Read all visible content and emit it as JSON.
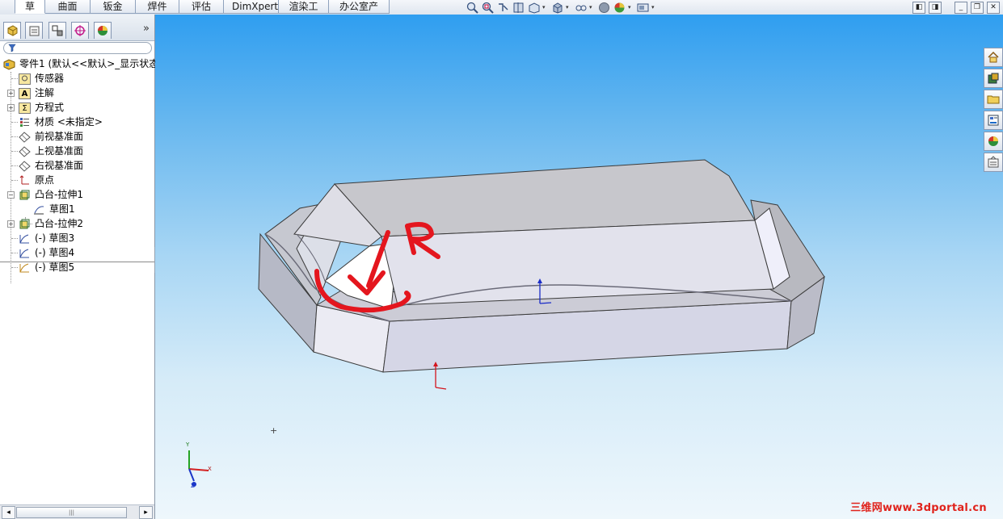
{
  "tabs": [
    "草图",
    "曲面",
    "钣金",
    "焊件",
    "评估",
    "DimXpert",
    "渲染工具",
    "办公室产品"
  ],
  "active_tab": "草图",
  "headsup_icons": [
    "zoom-to-fit-icon",
    "zoom-area-icon",
    "previous-view-icon",
    "section-view-icon",
    "view-orientation-icon",
    "display-style-icon",
    "hide-show-icon",
    "edit-appearance-icon",
    "apply-scene-icon",
    "view-settings-icon"
  ],
  "window_controls": [
    "◧",
    "◨",
    "_",
    "❐",
    "✕"
  ],
  "feature_manager": {
    "tab_icons": [
      "featuremanager-icon",
      "propertymanager-icon",
      "configurationmanager-icon",
      "dimxpert-icon",
      "display-manager-icon"
    ],
    "more": "»",
    "filter_icon": "filter-icon",
    "root": "零件1 (默认<<默认>_显示状态",
    "items": [
      {
        "label": "传感器",
        "icon": "sensor-icon"
      },
      {
        "label": "注解",
        "icon": "annotation-icon"
      },
      {
        "label": "方程式",
        "icon": "equation-icon"
      },
      {
        "label": "材质 <未指定>",
        "icon": "material-icon"
      },
      {
        "label": "前视基准面",
        "icon": "plane-icon"
      },
      {
        "label": "上视基准面",
        "icon": "plane-icon"
      },
      {
        "label": "右视基准面",
        "icon": "plane-icon"
      },
      {
        "label": "原点",
        "icon": "origin-icon"
      },
      {
        "label": "凸台-拉伸1",
        "icon": "extrude-icon"
      },
      {
        "label": "草图1",
        "icon": "sketch-icon"
      },
      {
        "label": "凸台-拉伸2",
        "icon": "extrude-icon"
      },
      {
        "label": "(-) 草图3",
        "icon": "sketch-icon"
      },
      {
        "label": "(-) 草图4",
        "icon": "sketch-icon"
      },
      {
        "label": "(-) 草图5",
        "icon": "sketch-icon"
      }
    ]
  },
  "annotation": {
    "letter": "R"
  },
  "triad": {
    "x": "X",
    "y": "Y",
    "z": "Z"
  },
  "task_pane_icons": [
    "home-icon",
    "design-library-icon",
    "file-explorer-icon",
    "view-palette-icon",
    "appearances-icon",
    "custom-properties-icon"
  ],
  "watermark": "三维网www.3dportal.cn"
}
